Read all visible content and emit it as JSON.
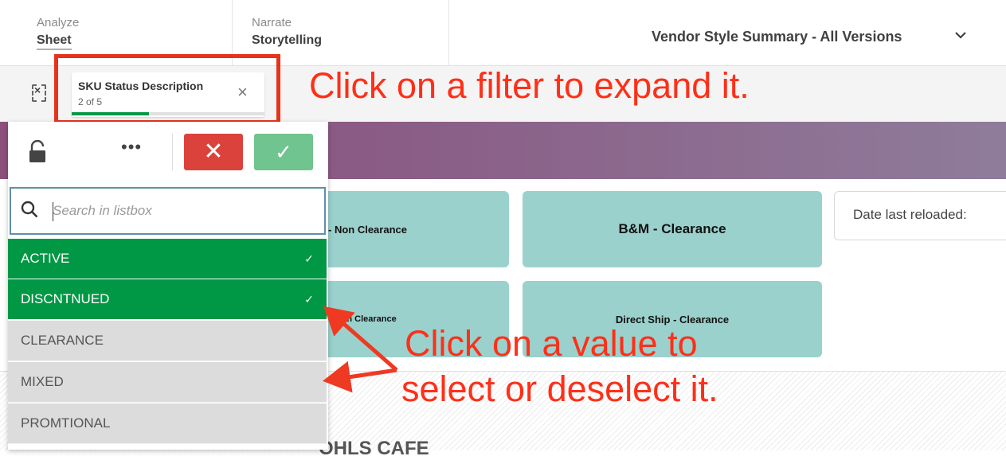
{
  "nav": {
    "tabs": [
      {
        "small": "Analyze",
        "label": "Sheet"
      },
      {
        "small": "Narrate",
        "label": "Storytelling"
      }
    ],
    "sheet_title": "Vendor Style Summary - All Versions",
    "sheet_chevron": "⌄"
  },
  "selection_bar": {
    "chip": {
      "title": "SKU Status Description",
      "count": "2 of 5",
      "close": "×",
      "progress_fraction": 0.4
    }
  },
  "listbox": {
    "toolbar": {
      "more": "•••",
      "cancel": "✕",
      "confirm": "✓"
    },
    "search_placeholder": "Search in listbox",
    "items": [
      {
        "label": "ACTIVE",
        "selected": true,
        "check": "✓"
      },
      {
        "label": "DISCNTNUED",
        "selected": true,
        "check": "✓"
      },
      {
        "label": "CLEARANCE",
        "selected": false
      },
      {
        "label": "MIXED",
        "selected": false
      },
      {
        "label": "PROMTIONAL",
        "selected": false
      }
    ]
  },
  "tiles": [
    {
      "label": "- Non Clearance"
    },
    {
      "label": "B&M - Clearance"
    },
    {
      "label": "- Non Clearance"
    },
    {
      "label": "Direct Ship - Clearance"
    }
  ],
  "reload_label": "Date last reloaded:",
  "bottom_heading": "OHLS CAFE",
  "annotations": {
    "callout_1": "Click on a filter to expand it.",
    "callout_2_line_1": "Click on a value to",
    "callout_2_line_2": "select or deselect it."
  },
  "colors": {
    "annotation_red": "#ff2f18",
    "selected_green": "#009845",
    "cancel_red": "#dc423c",
    "confirm_green": "#70c48f",
    "tile_teal": "#9ad1cd"
  }
}
